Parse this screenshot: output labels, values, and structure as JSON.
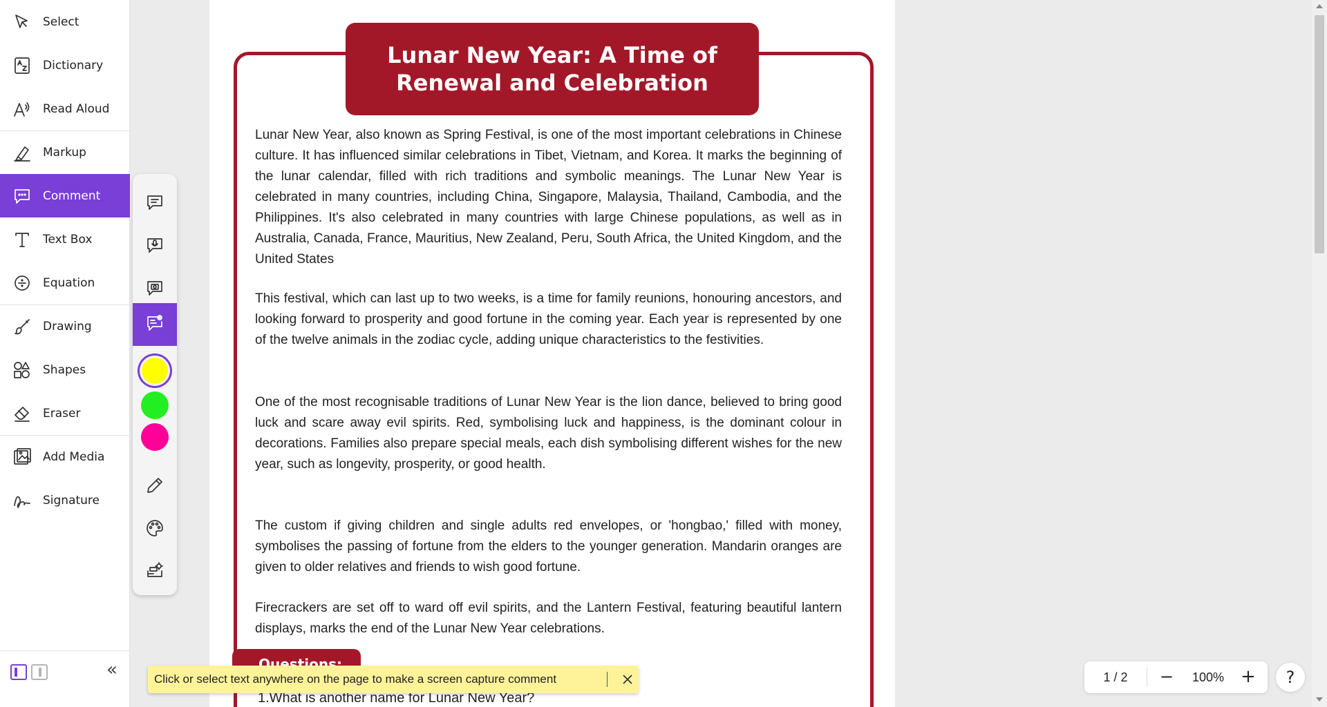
{
  "sidebar": {
    "items": [
      {
        "label": "Select",
        "icon": "cursor-arrow-icon"
      },
      {
        "label": "Dictionary",
        "icon": "dictionary-icon"
      },
      {
        "label": "Read Aloud",
        "icon": "read-aloud-icon"
      },
      {
        "label": "Markup",
        "icon": "highlighter-icon"
      },
      {
        "label": "Comment",
        "icon": "comment-icon",
        "active": true
      },
      {
        "label": "Text Box",
        "icon": "text-box-icon"
      },
      {
        "label": "Equation",
        "icon": "equation-icon"
      },
      {
        "label": "Drawing",
        "icon": "brush-icon"
      },
      {
        "label": "Shapes",
        "icon": "shapes-icon"
      },
      {
        "label": "Eraser",
        "icon": "eraser-icon"
      },
      {
        "label": "Add Media",
        "icon": "add-media-icon"
      },
      {
        "label": "Signature",
        "icon": "signature-icon"
      }
    ],
    "footer": {
      "collapse_glyph": "«"
    }
  },
  "comment_toolbar": {
    "tools": [
      {
        "name": "text-comment",
        "icon": "text-comment-icon"
      },
      {
        "name": "voice-comment",
        "icon": "voice-comment-icon"
      },
      {
        "name": "video-comment",
        "icon": "video-comment-icon"
      },
      {
        "name": "screen-capture-comment",
        "icon": "screen-capture-comment-icon",
        "active": true
      }
    ],
    "colors": [
      "#ffff00",
      "#22ee22",
      "#ff0099"
    ],
    "selected_color": "#ffff00",
    "extra_tools": [
      {
        "name": "pen",
        "icon": "pen-icon"
      },
      {
        "name": "palette",
        "icon": "palette-icon"
      },
      {
        "name": "settings",
        "icon": "comment-settings-icon"
      }
    ]
  },
  "document": {
    "title": "Lunar New Year: A Time of Renewal and Celebration",
    "paragraphs": [
      "Lunar New Year, also known as Spring Festival, is one of the most important celebrations in Chinese culture. It has influenced similar celebrations in Tibet, Vietnam, and Korea. It marks the beginning of the lunar calendar, filled with rich traditions and symbolic meanings. The Lunar New Year is celebrated in many countries, including China, Singapore, Malaysia, Thailand, Cambodia, and the Philippines. It's also celebrated in many countries with large Chinese populations, as well as in Australia, Canada, France, Mauritius, New Zealand, Peru, South Africa, the United Kingdom, and the United States",
      "This festival, which can last up to two weeks, is a time for family reunions, honouring ancestors, and looking forward to prosperity and good fortune in the coming year. Each year is represented by one of the twelve animals in the zodiac cycle, adding unique characteristics to the festivities.",
      "One of the most recognisable traditions of Lunar New Year is the lion dance, believed to bring good luck and scare away evil spirits. Red, symbolising luck and happiness, is the dominant colour in decorations. Families also prepare special meals, each dish symbolising different wishes for the new year, such as longevity, prosperity, or good health.",
      "The custom if giving children and single adults red envelopes, or 'hongbao,' filled with money, symbolises the passing of fortune from the elders to the younger generation. Mandarin oranges are given to older relatives and friends to wish good fortune.",
      "Firecrackers are set off to ward off evil spirits, and the Lantern Festival, featuring beautiful lantern displays, marks the end of the Lunar New Year celebrations."
    ],
    "questions_heading": "Questions:",
    "first_question": "1.What is another name for Lunar New Year?",
    "accent_color": "#a31829"
  },
  "banner": {
    "message": "Click or select text anywhere on the page to make a screen capture comment",
    "close_icon": "close-icon"
  },
  "zoom": {
    "page_indicator": "1 / 2",
    "zoom_level": "100%",
    "minus": "−",
    "plus": "+"
  },
  "help": {
    "label": "?"
  },
  "colors": {
    "accent_purple": "#7a3fd6",
    "doc_red": "#a31829",
    "banner_yellow": "#fff39a"
  }
}
